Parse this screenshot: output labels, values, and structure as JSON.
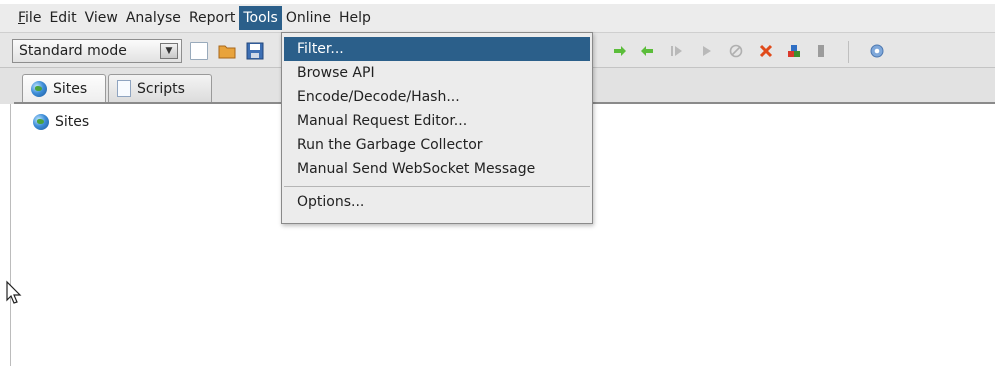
{
  "menubar": {
    "items": [
      {
        "mnemonic": "F",
        "rest": "ile"
      },
      {
        "mnemonic": "",
        "rest": "Edit"
      },
      {
        "mnemonic": "",
        "rest": "View"
      },
      {
        "mnemonic": "",
        "rest": "Analyse"
      },
      {
        "mnemonic": "",
        "rest": "Report"
      },
      {
        "mnemonic": "",
        "rest": "Tools"
      },
      {
        "mnemonic": "",
        "rest": "Online"
      },
      {
        "mnemonic": "",
        "rest": "Help"
      }
    ]
  },
  "toolbar": {
    "mode_value": "Standard mode",
    "icons": [
      "new-session-icon",
      "open-session-icon",
      "save-session-icon"
    ],
    "right_icons": [
      "arrow-right-icon",
      "arrow-left-icon",
      "step-icon",
      "play-icon",
      "stop-circle-icon",
      "x-tools-icon",
      "blocks-icon",
      "bar-icon",
      "help-icon"
    ]
  },
  "tabs": [
    {
      "label": "Sites"
    },
    {
      "label": "Scripts"
    }
  ],
  "tree": {
    "root_label": "Sites"
  },
  "tools_menu": {
    "items": [
      {
        "label": "Filter..."
      },
      {
        "label": "Browse API"
      },
      {
        "label": "Encode/Decode/Hash..."
      },
      {
        "label": "Manual Request Editor..."
      },
      {
        "label": "Run the Garbage Collector"
      },
      {
        "label": "Manual Send WebSocket Message"
      }
    ],
    "footer_items": [
      {
        "label": "Options..."
      }
    ]
  },
  "colors": {
    "highlight": "#2b5f8a",
    "menu_bg": "#ececec"
  }
}
